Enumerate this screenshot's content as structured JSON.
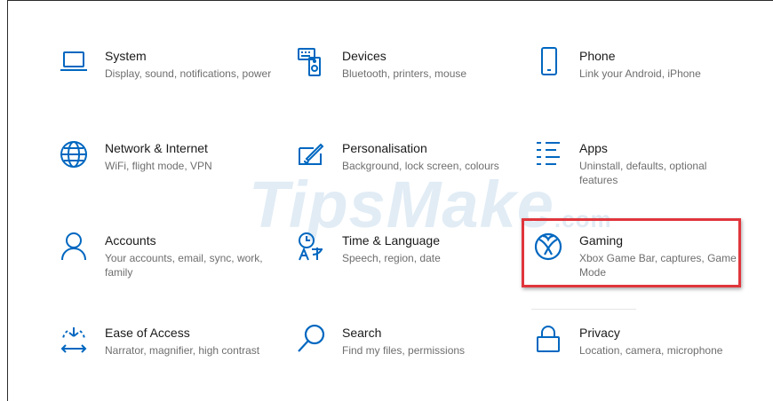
{
  "settings": {
    "tiles": [
      {
        "title": "System",
        "subtitle": "Display, sound, notifications, power",
        "icon": "laptop-icon"
      },
      {
        "title": "Devices",
        "subtitle": "Bluetooth, printers, mouse",
        "icon": "keyboard-speaker-icon"
      },
      {
        "title": "Phone",
        "subtitle": "Link your Android, iPhone",
        "icon": "phone-icon"
      },
      {
        "title": "Network & Internet",
        "subtitle": "WiFi, flight mode, VPN",
        "icon": "globe-icon"
      },
      {
        "title": "Personalisation",
        "subtitle": "Background, lock screen, colours",
        "icon": "paint-brush-icon"
      },
      {
        "title": "Apps",
        "subtitle": "Uninstall, defaults, optional features",
        "icon": "apps-list-icon"
      },
      {
        "title": "Accounts",
        "subtitle": "Your accounts, email, sync, work, family",
        "icon": "person-icon"
      },
      {
        "title": "Time & Language",
        "subtitle": "Speech, region, date",
        "icon": "time-language-icon"
      },
      {
        "title": "Gaming",
        "subtitle": "Xbox Game Bar, captures, Game Mode",
        "icon": "xbox-icon"
      },
      {
        "title": "Ease of Access",
        "subtitle": "Narrator, magnifier, high contrast",
        "icon": "ease-of-access-icon"
      },
      {
        "title": "Search",
        "subtitle": "Find my files, permissions",
        "icon": "search-icon"
      },
      {
        "title": "Privacy",
        "subtitle": "Location, camera, microphone",
        "icon": "lock-icon"
      }
    ]
  },
  "watermark": {
    "text": "TipsMake",
    "suffix": ".com"
  },
  "colors": {
    "accent": "#0067c0",
    "highlight": "#e0363c"
  }
}
